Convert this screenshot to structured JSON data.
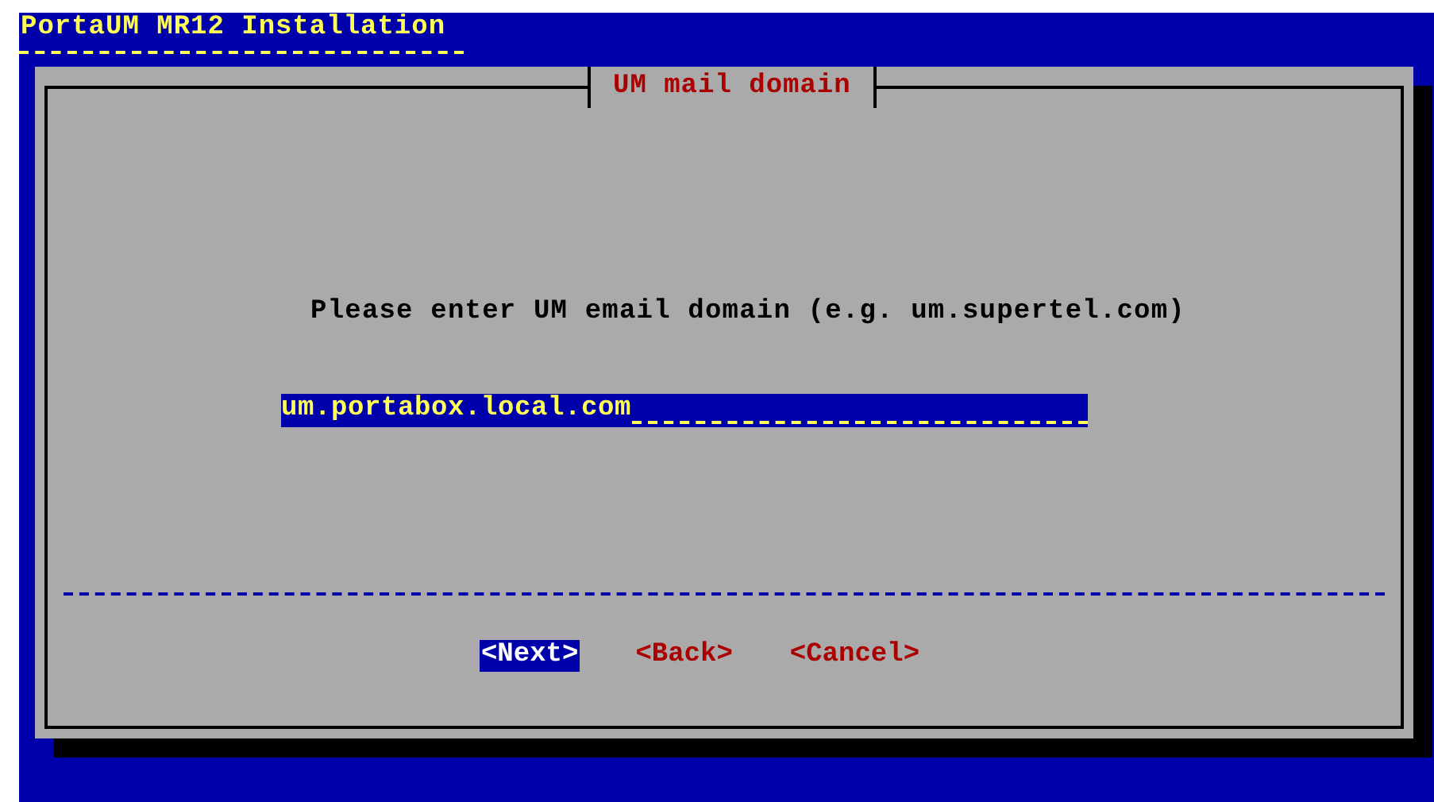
{
  "window": {
    "title": "PortaUM MR12 Installation"
  },
  "dialog": {
    "title": "UM mail domain",
    "prompt": "Please enter UM email domain (e.g. um.supertel.com)",
    "field": {
      "value": "um.portabox.local.com"
    },
    "buttons": [
      {
        "label": "<Next>",
        "selected": true
      },
      {
        "label": "<Back>",
        "selected": false
      },
      {
        "label": "<Cancel>",
        "selected": false
      }
    ]
  }
}
